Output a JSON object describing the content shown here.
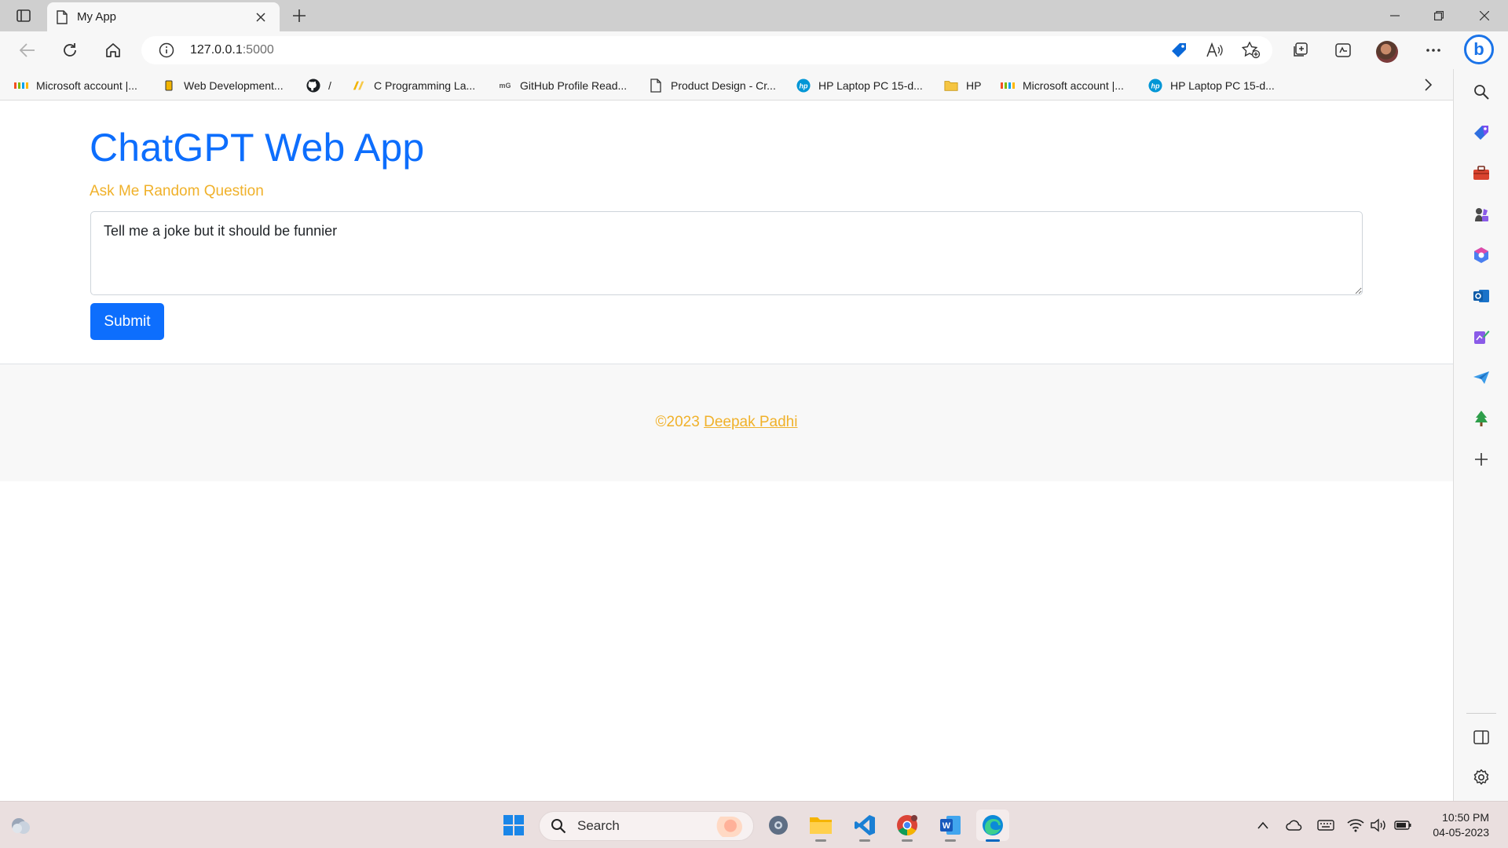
{
  "browser": {
    "tab": {
      "title": "My App"
    },
    "address": {
      "host": "127.0.0.1",
      "port": ":5000"
    },
    "favorites": [
      {
        "label": "Microsoft account |...",
        "icon": "microsoft-logo-icon"
      },
      {
        "label": "Web Development...",
        "icon": "bookmark-icon"
      },
      {
        "label": "/",
        "icon": "github-icon"
      },
      {
        "label": "C Programming La...",
        "icon": "site-icon"
      },
      {
        "label": "GitHub Profile Read...",
        "icon": "site-icon"
      },
      {
        "label": "Product Design - Cr...",
        "icon": "page-icon"
      },
      {
        "label": "HP Laptop PC 15-d...",
        "icon": "hp-icon"
      },
      {
        "label": "HP",
        "icon": "folder-icon"
      },
      {
        "label": "Microsoft account |...",
        "icon": "microsoft-logo-icon"
      },
      {
        "label": "HP Laptop PC 15-d...",
        "icon": "hp-icon"
      }
    ]
  },
  "page": {
    "title": "ChatGPT Web App",
    "subtitle": "Ask Me Random Question",
    "question_value": "Tell me a joke but it should be funnier",
    "submit_label": "Submit",
    "footer": {
      "copyright": "©2023",
      "author": "Deepak Padhi"
    }
  },
  "taskbar": {
    "search_label": "Search",
    "time": "10:50 PM",
    "date": "04-05-2023"
  },
  "colors": {
    "primary": "#0d6efd",
    "accent": "#f0b12a",
    "chrome": "#f7f7f7",
    "taskbar": "#eadfdf"
  }
}
